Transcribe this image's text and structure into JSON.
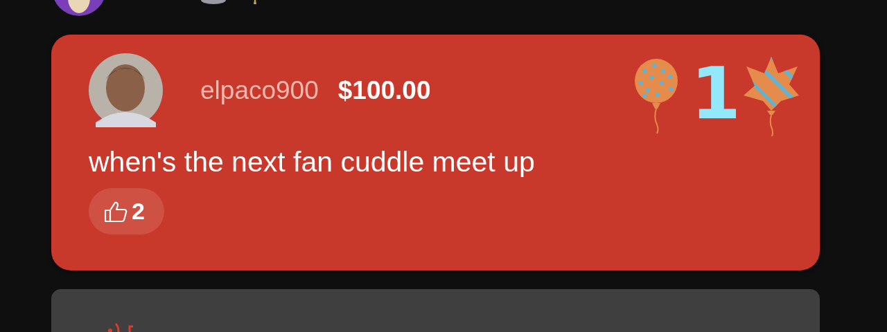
{
  "superchat": {
    "username": "elpaco900",
    "amount": "$100.00",
    "badge": "1",
    "message": "when's the next fan cuddle meet up",
    "likes": {
      "count": "2"
    }
  }
}
